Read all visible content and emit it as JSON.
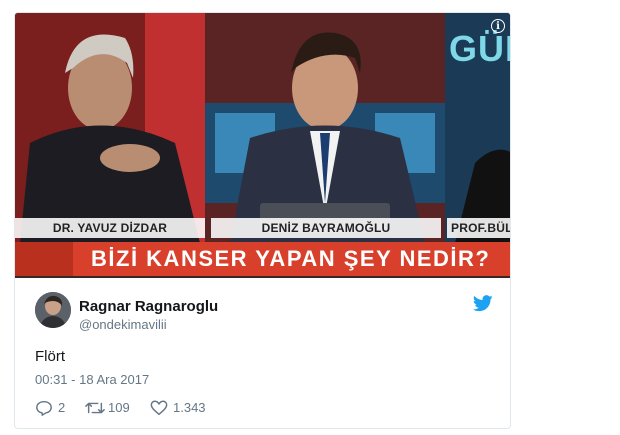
{
  "media": {
    "lower_thirds": [
      "DR. YAVUZ DİZDAR",
      "DENİZ BAYRAMOĞLU",
      "PROF.BÜLE"
    ],
    "headline": "BİZİ KANSER YAPAN ŞEY NEDİR?",
    "channel_logo": "GÜN",
    "info_icon": "info-icon",
    "colors": {
      "headline_bg": "#d9402b",
      "logo_text": "#7fd8e8"
    }
  },
  "author": {
    "display_name": "Ragnar Ragnaroglu",
    "handle": "@ondekimavilii"
  },
  "tweet": {
    "text": "Flört",
    "timestamp": "00:31 - 18 Ara 2017"
  },
  "actions": {
    "replies": "2",
    "retweets": "109",
    "likes": "1.343"
  },
  "colors": {
    "twitter_blue": "#1da1f2",
    "meta_text": "#657786"
  }
}
